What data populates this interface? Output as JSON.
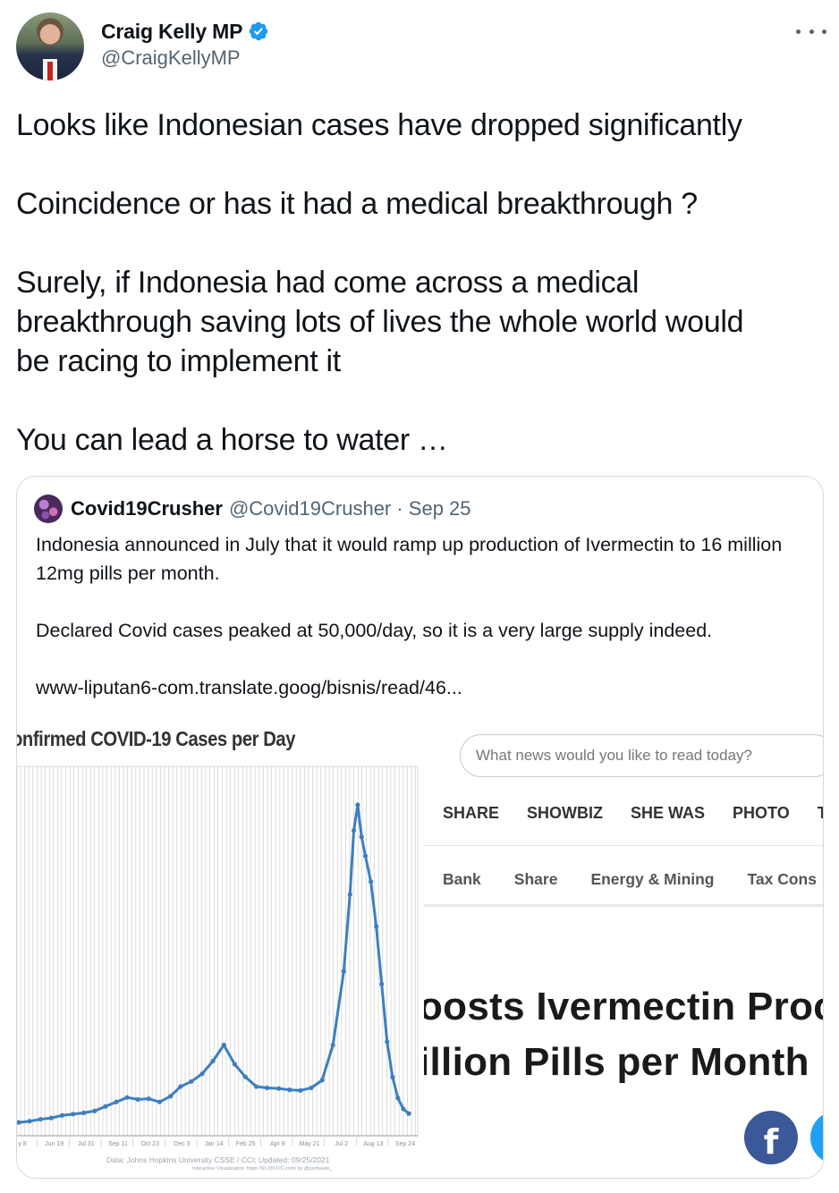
{
  "tweet": {
    "author_name": "Craig Kelly MP",
    "author_handle": "@CraigKellyMP",
    "paragraphs": [
      "Looks like Indonesian cases have dropped significantly",
      "Coincidence or has it had a medical breakthrough ?",
      "Surely, if Indonesia had come across a medical\nbreakthrough saving lots of lives the whole world would\nbe racing to implement it",
      "You can lead a horse to water …"
    ]
  },
  "quoted_tweet": {
    "author_name": "Covid19Crusher",
    "author_handle": "@Covid19Crusher · Sep 25",
    "paragraphs": [
      "Indonesia announced in July that it would ramp up production of Ivermectin to 16 million 12mg pills per month.",
      "Declared Covid cases peaked at 50,000/day, so it is a very large supply indeed.",
      "www-liputan6-com.translate.goog/bisnis/read/46..."
    ]
  },
  "chart_data": {
    "type": "line",
    "title": "onfirmed COVID-19 Cases per Day",
    "x_tick_labels": [
      "y 8",
      "Jun 19",
      "Jul 31",
      "Sep 11",
      "Oct 23",
      "Dec 3",
      "Jan 14",
      "Feb 25",
      "Apr 9",
      "May 21",
      "Jul 2",
      "Aug 13",
      "Sep 24"
    ],
    "x": [
      "2020-05-08",
      "2020-05-22",
      "2020-06-05",
      "2020-06-19",
      "2020-07-03",
      "2020-07-17",
      "2020-07-31",
      "2020-08-14",
      "2020-08-28",
      "2020-09-11",
      "2020-09-25",
      "2020-10-09",
      "2020-10-23",
      "2020-11-06",
      "2020-11-20",
      "2020-12-03",
      "2020-12-17",
      "2020-12-31",
      "2021-01-14",
      "2021-01-28",
      "2021-02-11",
      "2021-02-25",
      "2021-03-11",
      "2021-03-25",
      "2021-04-09",
      "2021-04-23",
      "2021-05-07",
      "2021-05-21",
      "2021-06-04",
      "2021-06-18",
      "2021-07-02",
      "2021-07-10",
      "2021-07-15",
      "2021-07-20",
      "2021-07-25",
      "2021-07-30",
      "2021-08-06",
      "2021-08-13",
      "2021-08-20",
      "2021-08-27",
      "2021-09-03",
      "2021-09-10",
      "2021-09-17",
      "2021-09-24"
    ],
    "values": [
      400,
      600,
      900,
      1100,
      1500,
      1700,
      1900,
      2200,
      2900,
      3600,
      4300,
      4000,
      4100,
      3600,
      4500,
      6000,
      6800,
      8000,
      10000,
      12500,
      9500,
      7500,
      6000,
      5800,
      5700,
      5500,
      5400,
      5800,
      7000,
      12500,
      24000,
      36000,
      46000,
      50000,
      45000,
      42000,
      38000,
      31000,
      22000,
      13000,
      7500,
      4200,
      2500,
      1800
    ],
    "series": [
      {
        "color": "#3d7fc0"
      }
    ],
    "xlabel": "",
    "ylabel": "",
    "ylim": [
      0,
      56000
    ],
    "grid": true,
    "source": "Data: Johns Hopkins University CSSE / CCI; Updated: 09/25/2021",
    "credit": "Interactive Visualization: https://91-DIVOC.com/ by @profwade_"
  },
  "news": {
    "search_placeholder": "What news would you like to read today?",
    "nav": [
      "SHARE",
      "SHOWBIZ",
      "SHE WAS",
      "PHOTO",
      "T"
    ],
    "subnav": [
      "Bank",
      "Share",
      "Energy & Mining",
      "Tax Cons"
    ],
    "headline_1": "oosts Ivermectin Proc",
    "headline_2": "illion Pills per Month",
    "fb_label": "f"
  },
  "colors": {
    "verified": "#1d9bf0",
    "secondary_text": "#536471",
    "line": "#3d7fc0",
    "facebook": "#3b5998",
    "twitter": "#1da1f2"
  }
}
